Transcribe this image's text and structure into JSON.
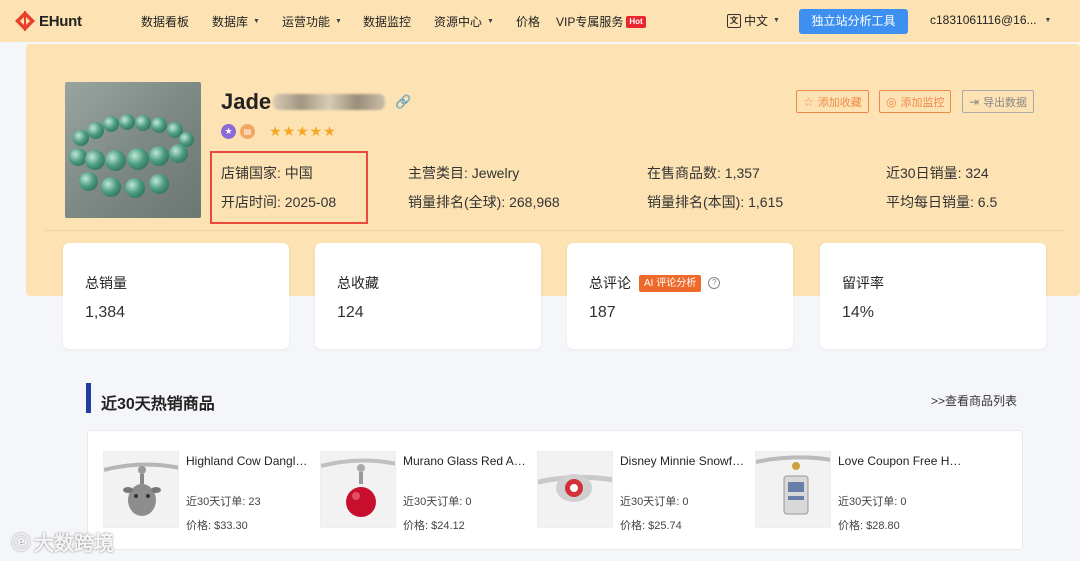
{
  "nav": {
    "logo": "EHunt",
    "items": [
      {
        "label": "数据看板",
        "caret": false
      },
      {
        "label": "数据库",
        "caret": true
      },
      {
        "label": "运营功能",
        "caret": true
      },
      {
        "label": "数据监控",
        "caret": false
      },
      {
        "label": "资源中心",
        "caret": true
      },
      {
        "label": "价格",
        "caret": false
      },
      {
        "label": "VIP专属服务",
        "caret": false
      }
    ],
    "hot_badge": "Hot",
    "language": "中文",
    "cta": "独立站分析工具",
    "user": "c1831061116@16..."
  },
  "store": {
    "name_visible": "Jade",
    "rating_stars": 5,
    "actions": {
      "favorite": "添加收藏",
      "monitor": "添加监控",
      "export": "导出数据"
    },
    "info": {
      "country": "店铺国家: 中国",
      "opened": "开店时间: 2025-08",
      "category": "主营类目: Jewelry",
      "global_rank": "销量排名(全球): 268,968",
      "on_sale": "在售商品数: 1,357",
      "local_rank": "销量排名(本国): 1,615",
      "sales_30d": "近30日销量: 324",
      "avg_daily": "平均每日销量: 6.5"
    }
  },
  "stats": {
    "total_sales": {
      "label": "总销量",
      "value": "1,384"
    },
    "total_favorites": {
      "label": "总收藏",
      "value": "124"
    },
    "total_reviews": {
      "label": "总评论",
      "value": "187",
      "badge": "AI 评论分析"
    },
    "review_rate": {
      "label": "留评率",
      "value": "14%"
    }
  },
  "hot": {
    "title": "近30天热销商品",
    "link": ">>查看商品列表",
    "products": [
      {
        "title": "Highland Cow Dangle Charm",
        "orders": "近30天订单: 23",
        "price": "价格: $33.30",
        "accent": "#8d8d8d"
      },
      {
        "title": "Murano Glass Red Apple Charm",
        "orders": "近30天订单: 0",
        "price": "价格: $24.12",
        "accent": "#c8102e"
      },
      {
        "title": "Disney Minnie Snowflake Charm",
        "orders": "近30天订单: 0",
        "price": "价格: $25.74",
        "accent": "#d4303a"
      },
      {
        "title": "Love Coupon Free Hugs Charm",
        "orders": "近30天订单: 0",
        "price": "价格: $28.80",
        "accent": "#6a7fa8"
      }
    ]
  },
  "watermark": "大数跨境",
  "colors": {
    "nav_bg": "#fde3b3",
    "cta": "#3d8ff0",
    "accent_orange": "#f0884a",
    "highlight_red": "#e84a3c",
    "section_bar": "#1e3fa0"
  }
}
